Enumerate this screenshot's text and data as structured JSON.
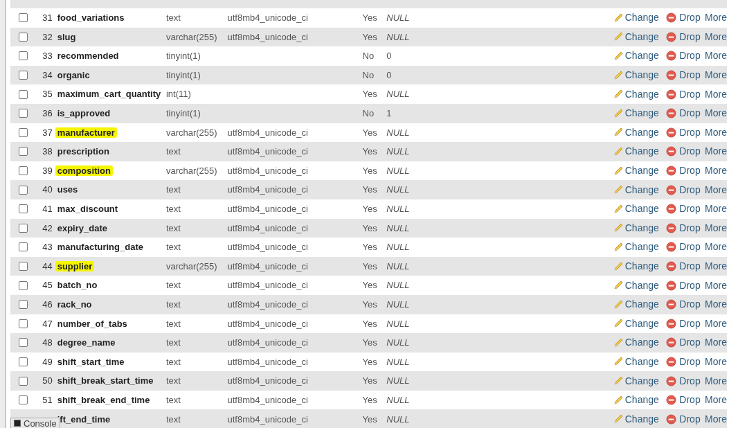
{
  "rows": [
    {
      "number": "31",
      "name": "food_variations",
      "highlighted": false,
      "type": "text",
      "collation": "utf8mb4_unicode_ci",
      "null": "Yes",
      "default": "NULL",
      "default_is_null": true,
      "checked": false,
      "change": "Change",
      "drop": "Drop",
      "more": "More"
    },
    {
      "number": "32",
      "name": "slug",
      "highlighted": false,
      "type": "varchar(255)",
      "collation": "utf8mb4_unicode_ci",
      "null": "Yes",
      "default": "NULL",
      "default_is_null": true,
      "checked": false,
      "change": "Change",
      "drop": "Drop",
      "more": "More"
    },
    {
      "number": "33",
      "name": "recommended",
      "highlighted": false,
      "type": "tinyint(1)",
      "null": "No",
      "default": "0",
      "default_is_null": false,
      "checked": false,
      "change": "Change",
      "drop": "Drop",
      "more": "More"
    },
    {
      "number": "34",
      "name": "organic",
      "highlighted": false,
      "type": "tinyint(1)",
      "null": "No",
      "default": "0",
      "default_is_null": false,
      "checked": false,
      "change": "Change",
      "drop": "Drop",
      "more": "More"
    },
    {
      "number": "35",
      "name": "maximum_cart_quantity",
      "highlighted": false,
      "type": "int(11)",
      "null": "Yes",
      "default": "NULL",
      "default_is_null": true,
      "checked": false,
      "change": "Change",
      "drop": "Drop",
      "more": "More"
    },
    {
      "number": "36",
      "name": "is_approved",
      "highlighted": false,
      "type": "tinyint(1)",
      "null": "No",
      "default": "1",
      "default_is_null": false,
      "checked": false,
      "change": "Change",
      "drop": "Drop",
      "more": "More"
    },
    {
      "number": "37",
      "name": "manufacturer",
      "highlighted": true,
      "type": "varchar(255)",
      "collation": "utf8mb4_unicode_ci",
      "null": "Yes",
      "default": "NULL",
      "default_is_null": true,
      "checked": false,
      "change": "Change",
      "drop": "Drop",
      "more": "More"
    },
    {
      "number": "38",
      "name": "prescription",
      "highlighted": false,
      "type": "text",
      "collation": "utf8mb4_unicode_ci",
      "null": "Yes",
      "default": "NULL",
      "default_is_null": true,
      "checked": false,
      "change": "Change",
      "drop": "Drop",
      "more": "More"
    },
    {
      "number": "39",
      "name": "composition",
      "highlighted": true,
      "type": "varchar(255)",
      "collation": "utf8mb4_unicode_ci",
      "null": "Yes",
      "default": "NULL",
      "default_is_null": true,
      "checked": false,
      "change": "Change",
      "drop": "Drop",
      "more": "More"
    },
    {
      "number": "40",
      "name": "uses",
      "highlighted": false,
      "type": "text",
      "collation": "utf8mb4_unicode_ci",
      "null": "Yes",
      "default": "NULL",
      "default_is_null": true,
      "checked": false,
      "change": "Change",
      "drop": "Drop",
      "more": "More"
    },
    {
      "number": "41",
      "name": "max_discount",
      "highlighted": false,
      "type": "text",
      "collation": "utf8mb4_unicode_ci",
      "null": "Yes",
      "default": "NULL",
      "default_is_null": true,
      "checked": false,
      "change": "Change",
      "drop": "Drop",
      "more": "More"
    },
    {
      "number": "42",
      "name": "expiry_date",
      "highlighted": false,
      "type": "text",
      "collation": "utf8mb4_unicode_ci",
      "null": "Yes",
      "default": "NULL",
      "default_is_null": true,
      "checked": false,
      "change": "Change",
      "drop": "Drop",
      "more": "More"
    },
    {
      "number": "43",
      "name": "manufacturing_date",
      "highlighted": false,
      "type": "text",
      "collation": "utf8mb4_unicode_ci",
      "null": "Yes",
      "default": "NULL",
      "default_is_null": true,
      "checked": false,
      "change": "Change",
      "drop": "Drop",
      "more": "More"
    },
    {
      "number": "44",
      "name": "supplier",
      "highlighted": true,
      "type": "varchar(255)",
      "collation": "utf8mb4_unicode_ci",
      "null": "Yes",
      "default": "NULL",
      "default_is_null": true,
      "checked": false,
      "change": "Change",
      "drop": "Drop",
      "more": "More"
    },
    {
      "number": "45",
      "name": "batch_no",
      "highlighted": false,
      "type": "text",
      "collation": "utf8mb4_unicode_ci",
      "null": "Yes",
      "default": "NULL",
      "default_is_null": true,
      "checked": false,
      "change": "Change",
      "drop": "Drop",
      "more": "More"
    },
    {
      "number": "46",
      "name": "rack_no",
      "highlighted": false,
      "type": "text",
      "collation": "utf8mb4_unicode_ci",
      "null": "Yes",
      "default": "NULL",
      "default_is_null": true,
      "checked": false,
      "change": "Change",
      "drop": "Drop",
      "more": "More"
    },
    {
      "number": "47",
      "name": "number_of_tabs",
      "highlighted": false,
      "type": "text",
      "collation": "utf8mb4_unicode_ci",
      "null": "Yes",
      "default": "NULL",
      "default_is_null": true,
      "checked": false,
      "change": "Change",
      "drop": "Drop",
      "more": "More"
    },
    {
      "number": "48",
      "name": "degree_name",
      "highlighted": false,
      "type": "text",
      "collation": "utf8mb4_unicode_ci",
      "null": "Yes",
      "default": "NULL",
      "default_is_null": true,
      "checked": false,
      "change": "Change",
      "drop": "Drop",
      "more": "More"
    },
    {
      "number": "49",
      "name": "shift_start_time",
      "highlighted": false,
      "type": "text",
      "collation": "utf8mb4_unicode_ci",
      "null": "Yes",
      "default": "NULL",
      "default_is_null": true,
      "checked": false,
      "change": "Change",
      "drop": "Drop",
      "more": "More"
    },
    {
      "number": "50",
      "name": "shift_break_start_time",
      "highlighted": false,
      "type": "text",
      "collation": "utf8mb4_unicode_ci",
      "null": "Yes",
      "default": "NULL",
      "default_is_null": true,
      "checked": false,
      "change": "Change",
      "drop": "Drop",
      "more": "More"
    },
    {
      "number": "51",
      "name": "shift_break_end_time",
      "highlighted": false,
      "type": "text",
      "collation": "utf8mb4_unicode_ci",
      "null": "Yes",
      "default": "NULL",
      "default_is_null": true,
      "checked": false,
      "change": "Change",
      "drop": "Drop",
      "more": "More"
    },
    {
      "name": "ift_end_time",
      "highlighted": false,
      "type": "text",
      "collation": "utf8mb4_unicode_ci",
      "null": "Yes",
      "default": "NULL",
      "default_is_null": true,
      "change": "Change",
      "drop": "Drop",
      "more": "More"
    }
  ],
  "console": {
    "label": "Console"
  }
}
